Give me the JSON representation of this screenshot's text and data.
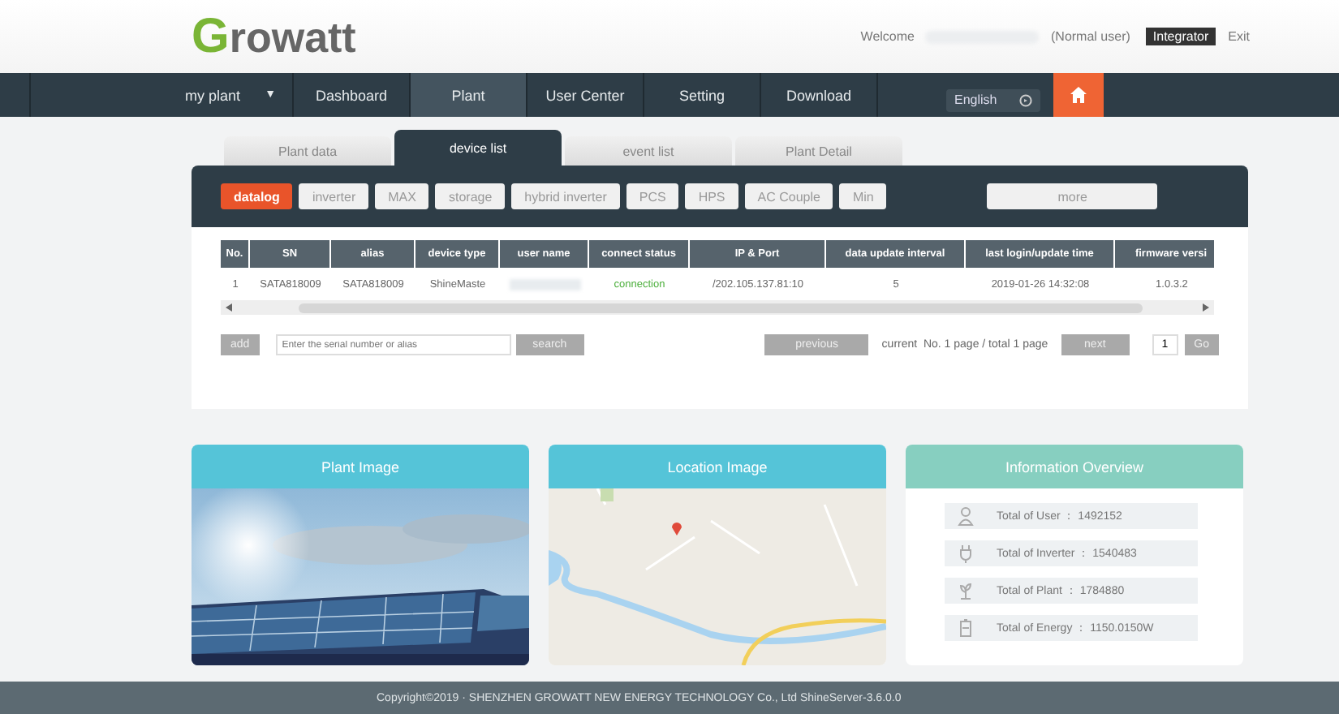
{
  "header": {
    "logo": "Growatt",
    "welcome": "Welcome",
    "user_role": "(Normal user)",
    "badge": "Integrator",
    "exit": "Exit"
  },
  "nav": {
    "plant_select": "my plant",
    "caret": "▼",
    "items": [
      {
        "label": "Dashboard",
        "selected": false
      },
      {
        "label": "Plant",
        "selected": true
      },
      {
        "label": "User Center",
        "selected": false
      },
      {
        "label": "Setting",
        "selected": false
      },
      {
        "label": "Download",
        "selected": false
      }
    ],
    "language": "English"
  },
  "tabs": [
    {
      "label": "Plant data",
      "selected": false
    },
    {
      "label": "device list",
      "selected": true
    },
    {
      "label": "event list",
      "selected": false
    },
    {
      "label": "Plant Detail",
      "selected": false
    }
  ],
  "device_types": [
    {
      "label": "datalog",
      "selected": true
    },
    {
      "label": "inverter",
      "selected": false
    },
    {
      "label": "MAX",
      "selected": false
    },
    {
      "label": "storage",
      "selected": false
    },
    {
      "label": "hybrid inverter",
      "selected": false
    },
    {
      "label": "PCS",
      "selected": false
    },
    {
      "label": "HPS",
      "selected": false
    },
    {
      "label": "AC Couple",
      "selected": false
    },
    {
      "label": "Min",
      "selected": false
    },
    {
      "label": "more",
      "selected": false
    }
  ],
  "table": {
    "columns": [
      "No.",
      "SN",
      "alias",
      "device type",
      "user name",
      "connect status",
      "IP & Port",
      "data update interval",
      "last login/update time",
      "firmware versi"
    ],
    "rows": [
      {
        "cells": [
          "1",
          "SATA818009",
          "SATA818009",
          "ShineMaste",
          "",
          "connection",
          "/202.105.137.81:10",
          "5",
          "2019-01-26 14:32:08",
          "1.0.3.2"
        ],
        "connected": true
      }
    ]
  },
  "search": {
    "add": "add",
    "placeholder": "Enter the serial number or alias",
    "button": "search"
  },
  "pager": {
    "previous": "previous",
    "info": "current  No. 1 page / total 1 page",
    "next": "next",
    "page": "1",
    "go": "Go"
  },
  "cards": [
    {
      "title": "Plant Image"
    },
    {
      "title": "Location Image"
    }
  ],
  "overview": {
    "title": "Information Overview",
    "items": [
      "Total of User ： 1492152",
      "Total of Inverter ： 1540483",
      "Total of Plant ： 1784880",
      "Total of Energy ： 1150.0150W"
    ]
  },
  "footer": "Copyright©2019 · SHENZHEN GROWATT NEW ENERGY TECHNOLOGY Co., Ltd ShineServer-3.6.0.0"
}
